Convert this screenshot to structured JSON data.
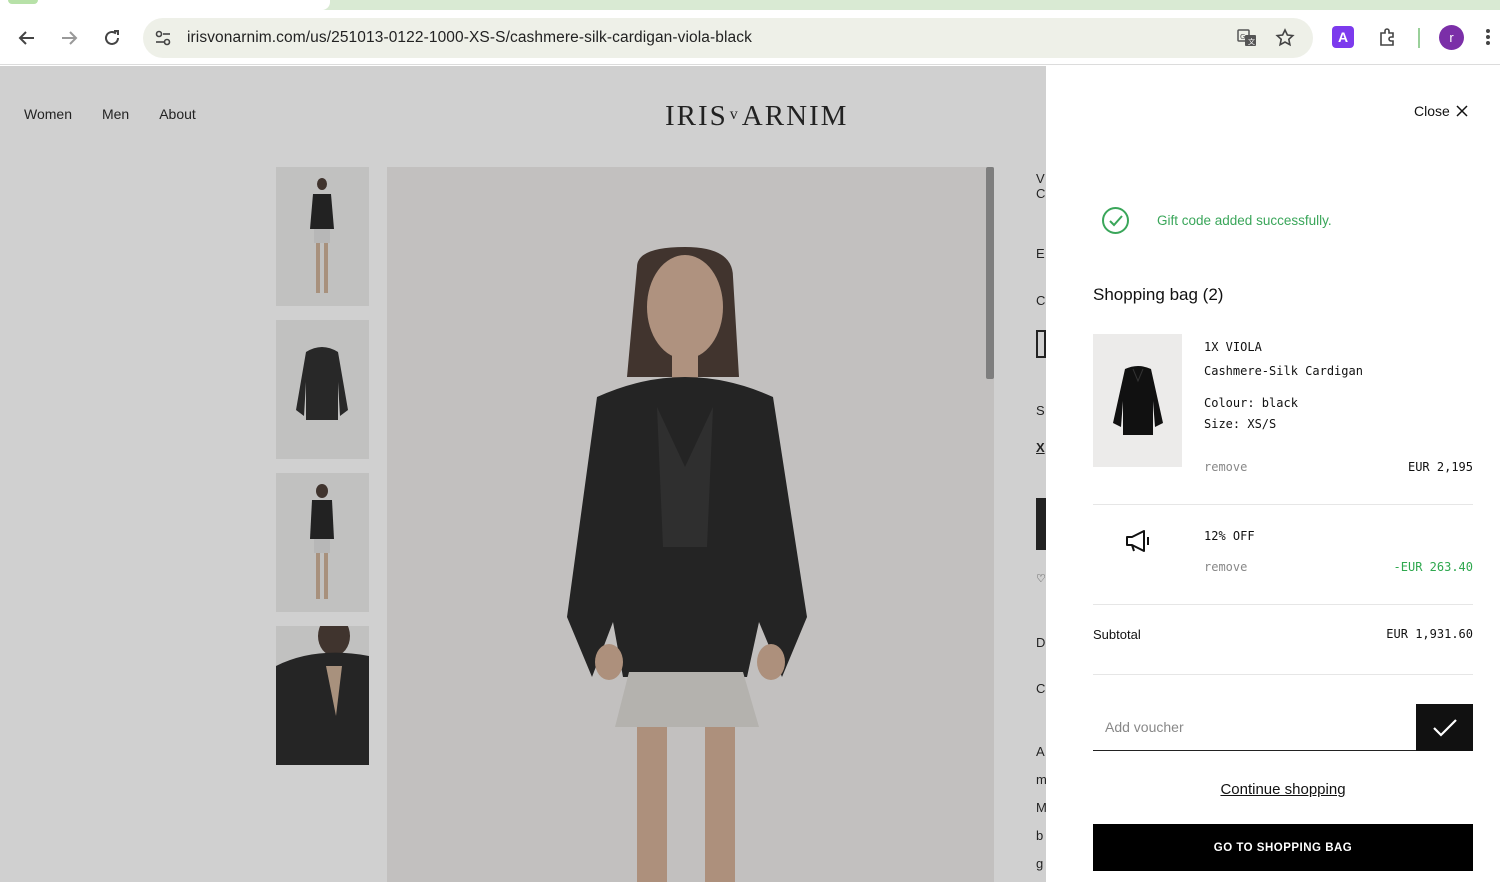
{
  "browser": {
    "url": "irisvonarnim.com/us/251013-0122-1000-XS-S/cashmere-silk-cardigan-viola-black",
    "profile_initial": "r",
    "extension_letter": "A"
  },
  "site": {
    "nav": [
      "Women",
      "Men",
      "About"
    ],
    "logo_left": "IRIS",
    "logo_v": "v",
    "logo_right": "ARNIM"
  },
  "drawer": {
    "close_label": "Close",
    "notice": "Gift code added successfully.",
    "bag_title": "Shopping bag (2)",
    "item": {
      "qty_name": "1X VIOLA",
      "product": "Cashmere-Silk Cardigan",
      "colour": "Colour: black",
      "size": "Size: XS/S",
      "remove": "remove",
      "price": "EUR 2,195"
    },
    "discount": {
      "label": "12% OFF",
      "remove": "remove",
      "amount": "-EUR 263.40"
    },
    "subtotal_label": "Subtotal",
    "subtotal_value": "EUR 1,931.60",
    "voucher_placeholder": "Add voucher",
    "continue_label": "Continue shopping",
    "goto_label": "GO TO SHOPPING BAG"
  },
  "colors": {
    "success_green": "#3aa65a",
    "discount_green": "#2fa84f",
    "profile_purple": "#7b2fa8"
  }
}
